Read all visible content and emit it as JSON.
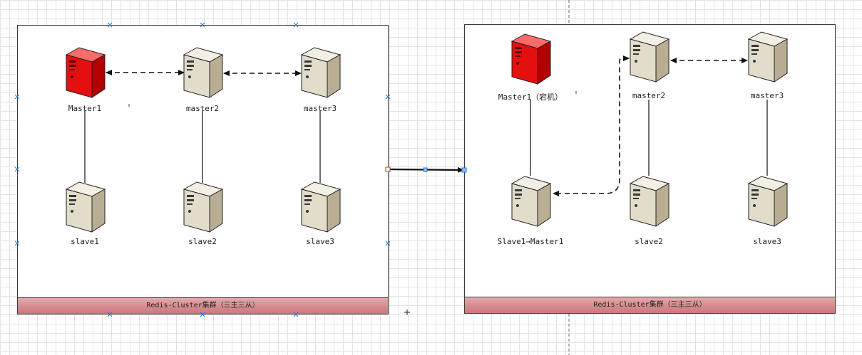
{
  "left_panel": {
    "footer": "Redis-Cluster集群（三主三从）",
    "nodes": {
      "m1": "Master1",
      "m2": "master2",
      "m3": "master3",
      "s1": "slave1",
      "s2": "slave2",
      "s3": "slave3"
    }
  },
  "right_panel": {
    "footer": "Redis-Cluster集群（三主三从）",
    "nodes": {
      "m1": "Master1（宕机）",
      "m2": "master2",
      "m3": "master3",
      "s1": "Slave1→Master1",
      "s2": "slave2",
      "s3": "slave3"
    }
  },
  "colors": {
    "failed_server": "#dd1111",
    "normal_server": "#e2dccb",
    "footer": "#d68a8e",
    "selection_handle": "#2b6fd6"
  },
  "icons": {
    "server": "server-tower-icon",
    "heartbeat": "dashed-double-arrow",
    "failover": "dashed-arrow"
  }
}
